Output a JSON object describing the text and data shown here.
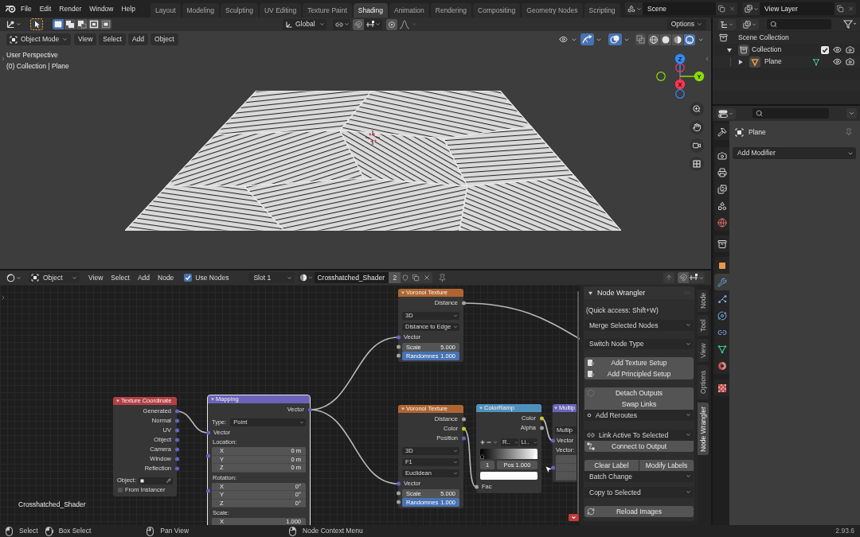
{
  "top_bar": {
    "menus": [
      "File",
      "Edit",
      "Render",
      "Window",
      "Help"
    ],
    "workspaces": [
      {
        "label": "Layout",
        "selected": false
      },
      {
        "label": "Modeling",
        "selected": false
      },
      {
        "label": "Sculpting",
        "selected": false
      },
      {
        "label": "UV Editing",
        "selected": false
      },
      {
        "label": "Texture Paint",
        "selected": false
      },
      {
        "label": "Shading",
        "selected": true
      },
      {
        "label": "Animation",
        "selected": false
      },
      {
        "label": "Rendering",
        "selected": false
      },
      {
        "label": "Compositing",
        "selected": false
      },
      {
        "label": "Geometry Nodes",
        "selected": false
      },
      {
        "label": "Scripting",
        "selected": false
      }
    ],
    "scene": "Scene",
    "view_layer": "View Layer"
  },
  "viewport": {
    "tool_header": {
      "selection_modes": [
        {
          "kind": "set",
          "selected": true
        },
        {
          "kind": "extend",
          "selected": false
        },
        {
          "kind": "subtract",
          "selected": false
        },
        {
          "kind": "difference",
          "selected": false
        },
        {
          "kind": "intersect",
          "selected": false
        }
      ],
      "orientation": "Global",
      "options": "Options"
    },
    "header": {
      "mode": "Object Mode",
      "menus": [
        "View",
        "Select",
        "Add",
        "Object"
      ],
      "toggles": [
        {
          "kind": "visibility",
          "on": false
        },
        {
          "kind": "gizmos",
          "on": true
        },
        {
          "kind": "overlays",
          "on": true
        },
        {
          "kind": "xray",
          "on": false
        }
      ],
      "shading": [
        {
          "kind": "wireframe",
          "selected": false
        },
        {
          "kind": "solid",
          "selected": false
        },
        {
          "kind": "material",
          "selected": false
        },
        {
          "kind": "rendered",
          "selected": true
        }
      ]
    },
    "info": [
      "User Perspective",
      "(0) Collection | Plane"
    ],
    "gizmo": [
      {
        "label": "Z",
        "color": "#2f8aff"
      },
      {
        "label": "Y",
        "color": "#8bdc00"
      },
      {
        "label": "X",
        "color": "#ff3352"
      }
    ]
  },
  "node_editor": {
    "header": {
      "object_type": "Object",
      "menus": [
        "View",
        "Select",
        "Add",
        "Node"
      ],
      "use_nodes": {
        "label": "Use Nodes",
        "checked": true
      },
      "slot": "Slot 1",
      "material": "Crosshatched_Shader",
      "users": "2"
    },
    "material_label": "Crosshatched_Shader",
    "nodes": [
      {
        "title": "Texture Coordinate",
        "kind": "input",
        "selected": false,
        "rows": [
          {
            "kind": "output",
            "label": "Generated",
            "color": "#6363c7"
          },
          {
            "kind": "output",
            "label": "Normal",
            "color": "#6363c7"
          },
          {
            "kind": "output",
            "label": "UV",
            "color": "#6363c7"
          },
          {
            "kind": "output",
            "label": "Object",
            "color": "#6363c7"
          },
          {
            "kind": "output",
            "label": "Camera",
            "color": "#6363c7"
          },
          {
            "kind": "output",
            "label": "Window",
            "color": "#6363c7"
          },
          {
            "kind": "output",
            "label": "Reflection",
            "color": "#6363c7"
          },
          {
            "kind": "object",
            "label": "Object:"
          },
          {
            "kind": "checkbox",
            "label": "From Instancer",
            "checked": false
          }
        ]
      },
      {
        "title": "Mapping",
        "kind": "vector",
        "selected": true,
        "rows": [
          {
            "kind": "output",
            "label": "Vector",
            "color": "#6363c7"
          },
          {
            "kind": "select",
            "label": "Type:",
            "value": "Point"
          },
          {
            "kind": "input",
            "label": "Vector",
            "color": "#6363c7"
          },
          {
            "kind": "label",
            "label": "Location:"
          },
          {
            "kind": "axis",
            "label": "X",
            "value": "0 m",
            "color": "#6363c7"
          },
          {
            "kind": "axis",
            "label": "Y",
            "value": "0 m"
          },
          {
            "kind": "axis",
            "label": "Z",
            "value": "0 m"
          },
          {
            "kind": "label",
            "label": "Rotation:"
          },
          {
            "kind": "axis",
            "label": "X",
            "value": "0°",
            "color": "#6363c7"
          },
          {
            "kind": "axis",
            "label": "Y",
            "value": "0°"
          },
          {
            "kind": "axis",
            "label": "Z",
            "value": "0°"
          },
          {
            "kind": "label",
            "label": "Scale:"
          },
          {
            "kind": "axis",
            "label": "X",
            "value": "1.000"
          }
        ]
      },
      {
        "title": "Voronoi Texture",
        "kind": "texture",
        "selected": false,
        "rows": [
          {
            "kind": "output",
            "label": "Distance",
            "color": "#a1a1a1"
          },
          {
            "kind": "select",
            "value": "3D"
          },
          {
            "kind": "select",
            "value": "Distance to Edge"
          },
          {
            "kind": "input",
            "label": "Vector",
            "color": "#6363c7"
          },
          {
            "kind": "field",
            "label": "Scale",
            "value": "5.000",
            "color": "#a1a1a1"
          },
          {
            "kind": "slider",
            "label": "Randomnes",
            "value": "1.000",
            "level": 1,
            "color": "#a1a1a1"
          }
        ]
      },
      {
        "title": "Voronoi Texture",
        "kind": "texture",
        "selected": false,
        "rows": [
          {
            "kind": "output",
            "label": "Distance",
            "color": "#a1a1a1"
          },
          {
            "kind": "output",
            "label": "Color",
            "color": "#c7c729"
          },
          {
            "kind": "output",
            "label": "Position",
            "color": "#6363c7"
          },
          {
            "kind": "select",
            "value": "3D"
          },
          {
            "kind": "select",
            "value": "F1"
          },
          {
            "kind": "select",
            "value": "Euclidean"
          },
          {
            "kind": "input",
            "label": "Vector",
            "color": "#6363c7"
          },
          {
            "kind": "field",
            "label": "Scale",
            "value": "5.000",
            "color": "#a1a1a1"
          },
          {
            "kind": "slider",
            "label": "Randomnes",
            "value": "1.000",
            "level": 1,
            "color": "#a1a1a1"
          }
        ]
      },
      {
        "title": "ColorRamp",
        "kind": "converter",
        "selected": false,
        "rows": [
          {
            "kind": "output",
            "label": "Color",
            "color": "#c7c729"
          },
          {
            "kind": "output",
            "label": "Alpha",
            "color": "#a1a1a1"
          },
          {
            "kind": "ramp",
            "color_mode": "R..",
            "interpolation": "Li..",
            "stop_index": "1",
            "position": "Pos 1.000",
            "stops": [
              {
                "level": 0,
                "color": "#000000",
                "selected": false
              },
              {
                "level": 1,
                "color": "#ffffff",
                "selected": true
              }
            ]
          },
          {
            "kind": "input",
            "label": "Fac",
            "color": "#a1a1a1"
          }
        ]
      },
      {
        "title": "Multip",
        "kind": "vector",
        "selected": false,
        "rows": [
          {
            "kind": "select",
            "value": "Multip"
          },
          {
            "kind": "input",
            "label": "Vector",
            "color": "#6363c7"
          },
          {
            "kind": "label",
            "label": "Vector:"
          },
          {
            "kind": "blank_fields",
            "color": "#6363c7"
          }
        ]
      }
    ],
    "sidebar": {
      "tabs": [
        {
          "label": "Node",
          "selected": false
        },
        {
          "label": "Tool",
          "selected": false
        },
        {
          "label": "View",
          "selected": false
        },
        {
          "label": "Options",
          "selected": false
        },
        {
          "label": "Node Wrangler",
          "selected": true
        }
      ],
      "panel": {
        "title": "Node Wrangler",
        "expanded": true,
        "hint": "(Quick access: Shift+W)",
        "groups": [
          {
            "items": [
              {
                "kind": "menu",
                "label": "Merge Selected Nodes"
              }
            ]
          },
          {
            "items": [
              {
                "kind": "menu",
                "label": "Switch Node Type"
              }
            ]
          },
          {
            "items": [
              {
                "kind": "button",
                "label": "Add Texture Setup"
              },
              {
                "kind": "button",
                "label": "Add Principled Setup"
              }
            ]
          },
          {
            "items": [
              {
                "kind": "button",
                "label": "Detach Outputs"
              },
              {
                "kind": "button",
                "label": "Swap Links"
              },
              {
                "kind": "menu",
                "label": "Add Reroutes"
              }
            ]
          },
          {
            "items": [
              {
                "kind": "menu",
                "label": "Link Active To Selected"
              },
              {
                "kind": "button",
                "label": "Connect to Output"
              }
            ]
          },
          {
            "items": [
              {
                "kind": "pair",
                "labels": [
                  "Clear Label",
                  "Modify Labels"
                ]
              },
              {
                "kind": "menu",
                "label": "Batch Change"
              }
            ]
          },
          {
            "items": [
              {
                "kind": "menu",
                "label": "Copy to Selected"
              }
            ]
          },
          {
            "items": [
              {
                "kind": "button",
                "label": "Reload Images"
              }
            ]
          }
        ]
      }
    }
  },
  "outliner": {
    "tree": [
      {
        "label": "Scene Collection",
        "kind": "scene",
        "children": [
          {
            "label": "Collection",
            "kind": "collection",
            "expanded": true,
            "checked": true,
            "children": [
              {
                "label": "Plane",
                "kind": "object",
                "expanded": false
              }
            ]
          }
        ]
      }
    ]
  },
  "properties": {
    "tabs": [
      {
        "kind": "tool",
        "selected": false
      },
      {
        "kind": "render",
        "selected": false
      },
      {
        "kind": "output",
        "selected": false
      },
      {
        "kind": "view_layer",
        "selected": false
      },
      {
        "kind": "scene",
        "selected": false
      },
      {
        "kind": "world",
        "selected": false
      },
      {
        "kind": "collection",
        "selected": false
      },
      {
        "kind": "object",
        "selected": false
      },
      {
        "kind": "modifiers",
        "selected": true
      },
      {
        "kind": "particles",
        "selected": false
      },
      {
        "kind": "physics",
        "selected": false
      },
      {
        "kind": "constraints",
        "selected": false
      },
      {
        "kind": "data",
        "selected": false
      },
      {
        "kind": "material",
        "selected": false
      },
      {
        "kind": "texture",
        "selected": false
      }
    ],
    "object_name": "Plane",
    "add_modifier": "Add Modifier"
  },
  "status_bar": {
    "hints": [
      {
        "kind": "left",
        "label": "Select"
      },
      {
        "kind": "left_drag",
        "label": "Box Select"
      },
      {
        "kind": "middle",
        "label": "Pan View"
      },
      {
        "kind": "right",
        "label": "Node Context Menu"
      }
    ],
    "version": "2.93.6"
  }
}
